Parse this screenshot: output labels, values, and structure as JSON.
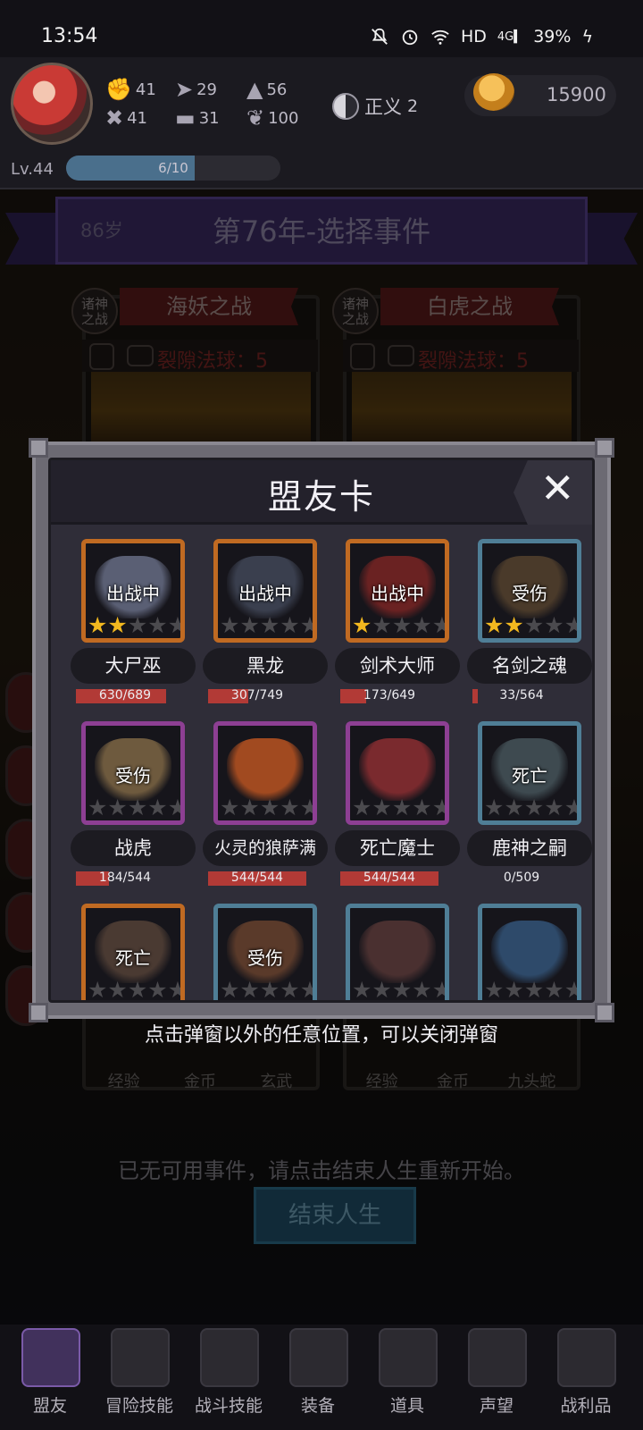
{
  "status_bar": {
    "time": "13:54",
    "network": "HD",
    "signal": "4G",
    "battery": "39%"
  },
  "hud": {
    "stats_row1": [
      "41",
      "29",
      "56"
    ],
    "stats_row2": [
      "41",
      "31",
      "100"
    ],
    "justice_label": "正义",
    "justice_value": "2",
    "gold": "15900",
    "level": "Lv.44",
    "xp_text": "6/10",
    "xp_fraction": 0.6
  },
  "banner": {
    "age": "86岁",
    "title": "第76年-选择事件"
  },
  "events": [
    {
      "badge": "诸神\n之战",
      "name": "海妖之战",
      "orb_label": "裂隙法球：5",
      "rewards": [
        "经验",
        "金币",
        "玄武"
      ]
    },
    {
      "badge": "诸神\n之战",
      "name": "白虎之战",
      "orb_label": "裂隙法球：5",
      "rewards": [
        "经验",
        "金币",
        "九头蛇"
      ]
    }
  ],
  "no_event_message": "已无可用事件，请点击结束人生重新开始。",
  "end_life_button": "结束人生",
  "modal": {
    "title": "盟友卡",
    "allies": [
      {
        "name": "大尸巫",
        "tag": "出战中",
        "stars": 2,
        "hp": "630/689",
        "hp_frac": 0.914,
        "frame": "gold",
        "art": "#5a5f74"
      },
      {
        "name": "黑龙",
        "tag": "出战中",
        "stars": 0,
        "hp": "307/749",
        "hp_frac": 0.41,
        "frame": "gold",
        "art": "#3a3f4e"
      },
      {
        "name": "剑术大师",
        "tag": "出战中",
        "stars": 1,
        "hp": "173/649",
        "hp_frac": 0.267,
        "frame": "gold",
        "art": "#6a2222"
      },
      {
        "name": "名剑之魂",
        "tag": "受伤",
        "stars": 2,
        "hp": "33/564",
        "hp_frac": 0.059,
        "frame": "blue",
        "art": "#4a3a2a"
      },
      {
        "name": "战虎",
        "tag": "受伤",
        "stars": 0,
        "hp": "184/544",
        "hp_frac": 0.338,
        "frame": "purple",
        "art": "#6e5a3e"
      },
      {
        "name": "火灵的狼萨满",
        "tag": "",
        "stars": 0,
        "hp": "544/544",
        "hp_frac": 1.0,
        "frame": "purple",
        "art": "#a14a20"
      },
      {
        "name": "死亡魔士",
        "tag": "",
        "stars": 0,
        "hp": "544/544",
        "hp_frac": 1.0,
        "frame": "purple",
        "art": "#7a2a2e"
      },
      {
        "name": "鹿神之嗣",
        "tag": "死亡",
        "stars": 0,
        "hp": "0/509",
        "hp_frac": 0.0,
        "frame": "blue",
        "art": "#3e4a50"
      },
      {
        "name": "",
        "tag": "死亡",
        "stars": 0,
        "hp": "",
        "hp_frac": 0,
        "frame": "gold",
        "art": "#4a3a32"
      },
      {
        "name": "",
        "tag": "受伤",
        "stars": 0,
        "hp": "",
        "hp_frac": 0,
        "frame": "blue",
        "art": "#5a3a2a"
      },
      {
        "name": "",
        "tag": "",
        "stars": 0,
        "hp": "",
        "hp_frac": 0,
        "frame": "blue",
        "art": "#4a3030"
      },
      {
        "name": "",
        "tag": "",
        "stars": 0,
        "hp": "",
        "hp_frac": 0,
        "frame": "blue",
        "art": "#2e4a6a"
      }
    ],
    "close_hint": "点击弹窗以外的任意位置，可以关闭弹窗"
  },
  "bottom_nav": [
    "盟友",
    "冒险技能",
    "战斗技能",
    "装备",
    "道具",
    "声望",
    "战利品"
  ],
  "colors": {
    "frame_gold": "#c06a22",
    "frame_blue": "#4f7e96",
    "frame_purple": "#8d3f93",
    "star_on": "#f2b81f",
    "hp_fill": "#b23a36"
  }
}
